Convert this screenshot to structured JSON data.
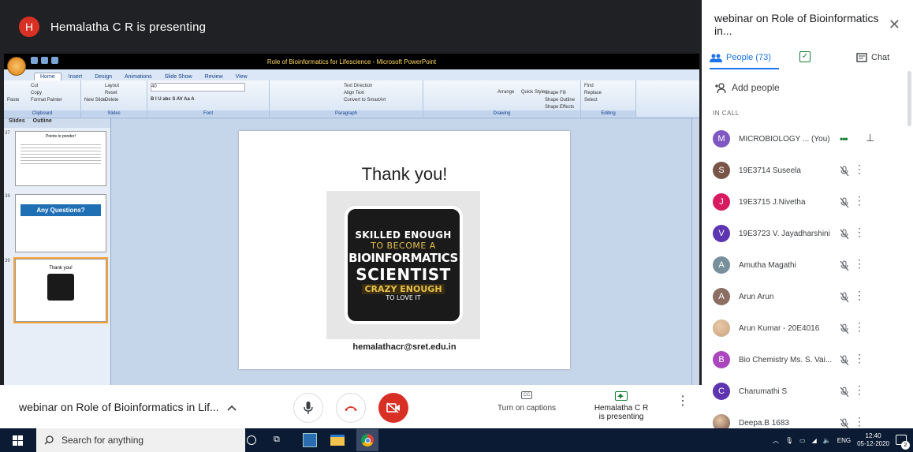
{
  "presenter": {
    "initial": "H",
    "title": "Hemalatha C R is presenting"
  },
  "ppt": {
    "window_title": "Role of Bioinformatics for Lifescience - Microsoft PowerPoint",
    "tabs": [
      "Home",
      "Insert",
      "Design",
      "Animations",
      "Slide Show",
      "Review",
      "View"
    ],
    "groups": [
      {
        "label": "Clipboard",
        "items": [
          "Cut",
          "Copy",
          "Paste",
          "Format Painter"
        ]
      },
      {
        "label": "Slides",
        "items": [
          "Layout",
          "Reset",
          "New Slide",
          "Delete"
        ]
      },
      {
        "label": "Font",
        "items": [
          "40",
          "B I U abc S AV Aa A"
        ]
      },
      {
        "label": "Paragraph",
        "items": [
          "Text Direction",
          "Align Text",
          "Convert to SmartArt"
        ]
      },
      {
        "label": "Drawing",
        "items": [
          "Arrange",
          "Quick Styles",
          "Shape Fill",
          "Shape Outline",
          "Shape Effects"
        ]
      },
      {
        "label": "Editing",
        "items": [
          "Find",
          "Replace",
          "Select"
        ]
      }
    ],
    "thumb_tabs": [
      "Slides",
      "Outline"
    ],
    "thumbnails": [
      {
        "num": "37",
        "title": "Points to ponder!"
      },
      {
        "num": "38",
        "title": "Any Questions?"
      },
      {
        "num": "39",
        "title": "Thank you!"
      }
    ],
    "slide": {
      "title": "Thank you!",
      "badge_lines": [
        "SKILLED ENOUGH",
        "TO BECOME A",
        "BIOINFORMATICS",
        "SCIENTIST",
        "CRAZY ENOUGH",
        "TO LOVE IT"
      ],
      "email": "hemalathacr@sret.edu.in"
    }
  },
  "bottom": {
    "meeting_title": "webinar on Role of Bioinformatics in Lif...",
    "captions_label": "Turn on captions",
    "captions_icon": "CC",
    "presenting_label": "Hemalatha C R is presenting"
  },
  "side": {
    "title": "webinar on Role of Bioinformatics in...",
    "people_tab": "People (73)",
    "chat_tab": "Chat",
    "add_people": "Add people",
    "in_call": "IN CALL",
    "people": [
      {
        "initial": "M",
        "name": "MICROBIOLOGY ... (You)",
        "color": "#7e57c2"
      },
      {
        "initial": "S",
        "name": "19E3714 Suseela",
        "color": "#795548"
      },
      {
        "initial": "J",
        "name": "19E3715 J.Nivetha",
        "color": "#d81b60"
      },
      {
        "initial": "V",
        "name": "19E3723 V. Jayadharshini",
        "color": "#5e35b1"
      },
      {
        "initial": "A",
        "name": "Amutha Magathi",
        "color": "#78909c"
      },
      {
        "initial": "A",
        "name": "Arun Arun",
        "color": "#8d6e63"
      },
      {
        "initial": "",
        "name": "Arun Kumar - 20E4016",
        "color": "#c9a27e"
      },
      {
        "initial": "B",
        "name": "Bio Chemistry Ms. S. Vai...",
        "color": "#ab47bc"
      },
      {
        "initial": "C",
        "name": "Charumathi S",
        "color": "#5e35b1"
      },
      {
        "initial": "",
        "name": "Deepa.B 1683",
        "color": "#6d4c41"
      }
    ]
  },
  "taskbar": {
    "search": "Search for anything",
    "lang": "ENG",
    "time": "12:40",
    "date": "05-12-2020",
    "notif_count": "2"
  }
}
